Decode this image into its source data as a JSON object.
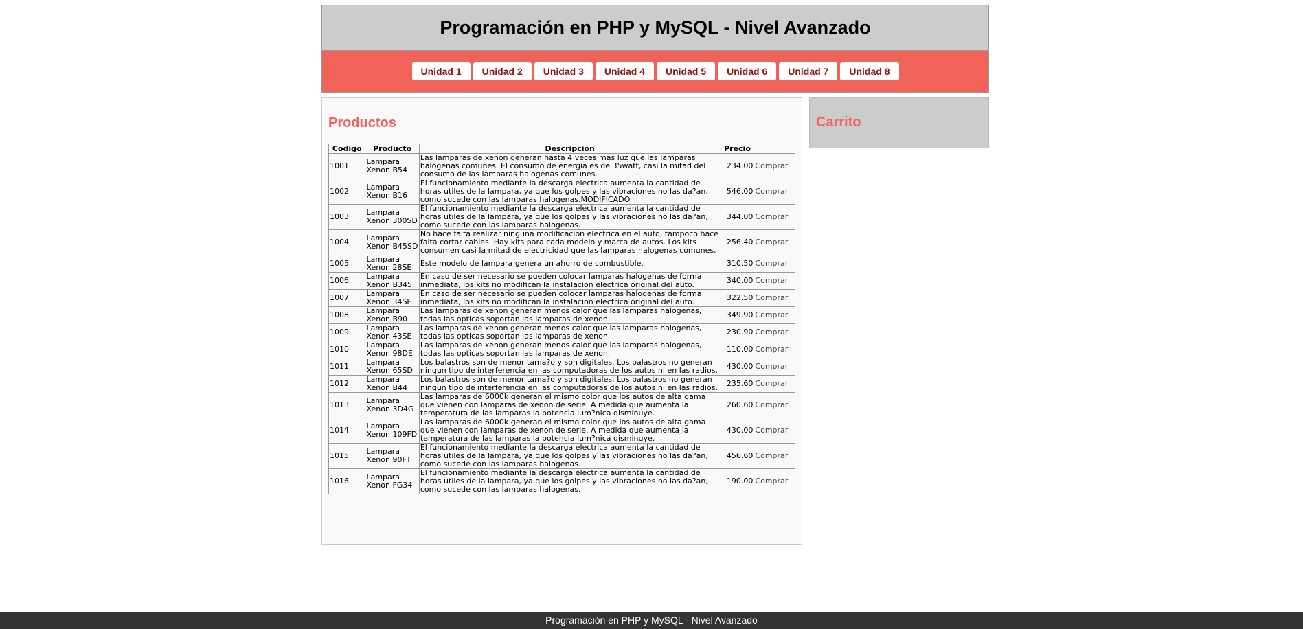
{
  "header": {
    "title": "Programación en PHP y MySQL - Nivel Avanzado"
  },
  "nav": [
    "Unidad 1",
    "Unidad 2",
    "Unidad 3",
    "Unidad 4",
    "Unidad 5",
    "Unidad 6",
    "Unidad 7",
    "Unidad 8"
  ],
  "productos": {
    "title": "Productos",
    "columns": [
      "Codigo",
      "Producto",
      "Descripcion",
      "Precio",
      ""
    ],
    "buy_label": "Comprar",
    "rows": [
      {
        "codigo": "1001",
        "producto": "Lampara Xenon B54",
        "descripcion": "Las lamparas de xenon generan hasta 4 veces mas luz que las lamparas halogenas comunes. El consumo de energia es de 35watt, casi la mitad del consumo de las lamparas halogenas comunes.",
        "precio": "234.00"
      },
      {
        "codigo": "1002",
        "producto": "Lampara Xenon B16",
        "descripcion": "El funcionamiento mediante la descarga electrica aumenta la cantidad de horas utiles de la lampara, ya que los golpes y las vibraciones no las da?an, como sucede con las lamparas halogenas.MODIFICADO",
        "precio": "546.00"
      },
      {
        "codigo": "1003",
        "producto": "Lampara Xenon 300SD",
        "descripcion": "El funcionamiento mediante la descarga electrica aumenta la cantidad de horas utiles de la lampara, ya que los golpes y las vibraciones no las da?an, como sucede con las lamparas halogenas.",
        "precio": "344.00"
      },
      {
        "codigo": "1004",
        "producto": "Lampara Xenon B45SD",
        "descripcion": "No hace falta realizar ninguna modificacion electrica en el auto, tampoco hace falta cortar cables. Hay kits para cada modelo y marca de autos. Los kits consumen casi la mitad de electricidad que las lamparas halogenas comunes.",
        "precio": "256.40"
      },
      {
        "codigo": "1005",
        "producto": "Lampara Xenon 28SE",
        "descripcion": "Este modelo de lampara genera un ahorro de combustible.",
        "precio": "310.50"
      },
      {
        "codigo": "1006",
        "producto": "Lampara Xenon B345",
        "descripcion": "En caso de ser necesario se pueden colocar lamparas halogenas de forma inmediata, los kits no modifican la instalacion electrica original del auto.",
        "precio": "340.00"
      },
      {
        "codigo": "1007",
        "producto": "Lampara Xenon 34SE",
        "descripcion": "En caso de ser necesario se pueden colocar lamparas halogenas de forma inmediata, los kits no modifican la instalacion electrica original del auto.",
        "precio": "322.50"
      },
      {
        "codigo": "1008",
        "producto": "Lampara Xenon B90",
        "descripcion": "Las lamparas de xenon generan menos calor que las lamparas halogenas, todas las opticas soportan las lamparas de xenon.",
        "precio": "349.90"
      },
      {
        "codigo": "1009",
        "producto": "Lampara Xenon 43SE",
        "descripcion": "Las lamparas de xenon generan menos calor que las lamparas halogenas, todas las opticas soportan las lamparas de xenon.",
        "precio": "230.90"
      },
      {
        "codigo": "1010",
        "producto": "Lampara Xenon 98DE",
        "descripcion": "Las lamparas de xenon generan menos calor que las lamparas halogenas, todas las opticas soportan las lamparas de xenon.",
        "precio": "110.00"
      },
      {
        "codigo": "1011",
        "producto": "Lampara Xenon 65SD",
        "descripcion": "Los balastros son de menor tama?o y son digitales. Los balastros no generan ningun tipo de interferencia en las computadoras de los autos ni en las radios.",
        "precio": "430.00"
      },
      {
        "codigo": "1012",
        "producto": "Lampara Xenon B44",
        "descripcion": "Los balastros son de menor tama?o y son digitales. Los balastros no generan ningun tipo de interferencia en las computadoras de los autos ni en las radios.",
        "precio": "235.60"
      },
      {
        "codigo": "1013",
        "producto": "Lampara Xenon 3D4G",
        "descripcion": "Las lamparas de 6000k generan el mismo color que los autos de alta gama que vienen con lamparas de xenon de serie. A medida que aumenta la temperatura de las lamparas la potencia lum?nica disminuye.",
        "precio": "260.60"
      },
      {
        "codigo": "1014",
        "producto": "Lampara Xenon 109FD",
        "descripcion": "Las lamparas de 6000k generan el mismo color que los autos de alta gama que vienen con lamparas de xenon de serie. A medida que aumenta la temperatura de las lamparas la potencia lum?nica disminuye.",
        "precio": "430.00"
      },
      {
        "codigo": "1015",
        "producto": "Lampara Xenon 90FT",
        "descripcion": "El funcionamiento mediante la descarga electrica aumenta la cantidad de horas utiles de la lampara, ya que los golpes y las vibraciones no las da?an, como sucede con las lamparas halogenas.",
        "precio": "456.60"
      },
      {
        "codigo": "1016",
        "producto": "Lampara Xenon FG34",
        "descripcion": "El funcionamiento mediante la descarga electrica aumenta la cantidad de horas utiles de la lampara, ya que los golpes y las vibraciones no las da?an, como sucede con las lamparas halogenas.",
        "precio": "190.00"
      }
    ]
  },
  "carrito": {
    "title": "Carrito"
  },
  "footer": {
    "text": "Programación en PHP y MySQL - Nivel Avanzado"
  },
  "colors": {
    "accent": "#f1635a",
    "header_bg": "#cccccc",
    "footer_bg": "#333333"
  }
}
